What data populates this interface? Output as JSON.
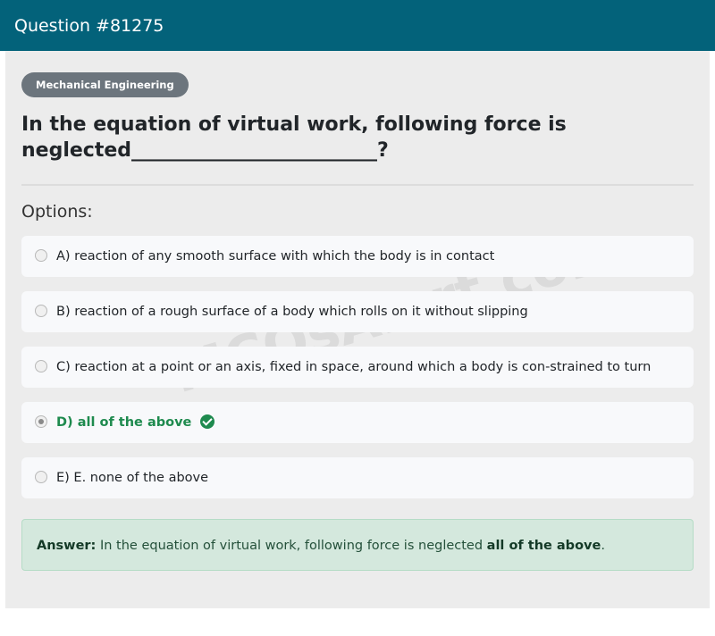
{
  "header": {
    "title": "Question #81275"
  },
  "question": {
    "category": "Mechanical Engineering",
    "text": "In the equation of virtual work, following force is neglected_________________________?"
  },
  "options_label": "Options:",
  "options": [
    {
      "label": "A) reaction of any smooth surface with which the body is in contact",
      "selected": false,
      "correct": false
    },
    {
      "label": "B) reaction of a rough surface of a body which rolls on it without slipping",
      "selected": false,
      "correct": false
    },
    {
      "label": "C) reaction at a point or an axis, fixed in space, around which a body is con-strained to turn",
      "selected": false,
      "correct": false
    },
    {
      "label": "D) all of the above",
      "selected": true,
      "correct": true
    },
    {
      "label": "E) E. none of the above",
      "selected": false,
      "correct": false
    }
  ],
  "answer": {
    "prefix": "Answer:",
    "text": " In the equation of virtual work, following force is neglected ",
    "value": "all of the above",
    "suffix": "."
  },
  "watermark": "MCQsAlert.com",
  "colors": {
    "header_bg": "#03627a",
    "correct": "#1e8a4e",
    "answer_bg": "#d4e8dd",
    "badge_bg": "#6c757d"
  }
}
